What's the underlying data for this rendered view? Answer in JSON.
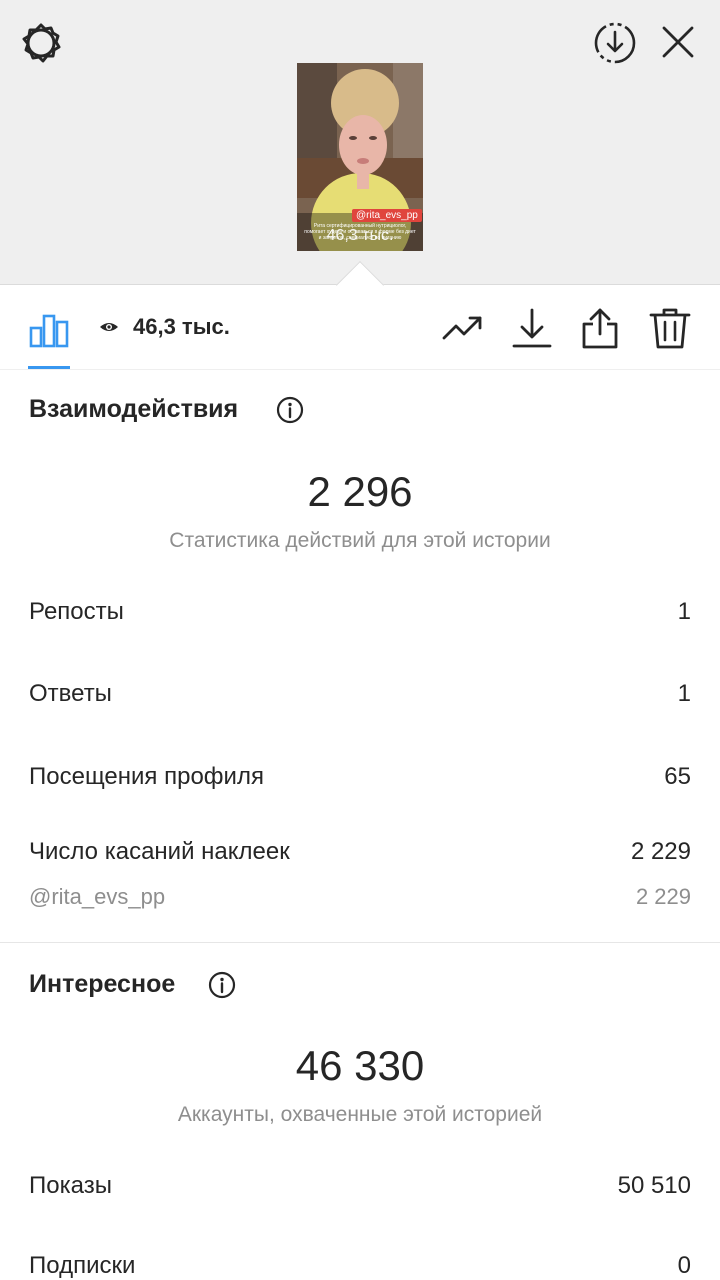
{
  "colors": {
    "accent": "#3897f0",
    "text": "#262626",
    "muted": "#8e8e8e",
    "background_top": "#efefef",
    "tag_red": "#e0453d"
  },
  "top_bar": {
    "icons": [
      "gear-icon",
      "download-circle-icon",
      "close-icon"
    ]
  },
  "story_thumbnail": {
    "tag": "@rita_evs_pp",
    "caption": "Рита сертифицированный нутрициолог, помогает худеть и оставаться в форме без диет и запретов, специалист по питанию",
    "views_overlay": "46,3 тыс."
  },
  "toolbar": {
    "views": "46,3 тыс.",
    "icons": [
      "bar-chart-icon",
      "eye-icon",
      "trending-icon",
      "download-icon",
      "share-icon",
      "trash-icon"
    ]
  },
  "interactions": {
    "title": "Взаимодействия",
    "total": "2 296",
    "subtitle": "Статистика действий для этой истории",
    "rows": [
      {
        "label": "Репосты",
        "value": "1"
      },
      {
        "label": "Ответы",
        "value": "1"
      },
      {
        "label": "Посещения профиля",
        "value": "65"
      },
      {
        "label": "Число касаний наклеек",
        "value": "2 229"
      }
    ],
    "sub_rows": [
      {
        "label": "@rita_evs_pp",
        "value": "2 229"
      }
    ]
  },
  "discovery": {
    "title": "Интересное",
    "total": "46 330",
    "subtitle": "Аккаунты, охваченные этой историей",
    "rows": [
      {
        "label": "Показы",
        "value": "50 510"
      },
      {
        "label": "Подписки",
        "value": "0"
      }
    ]
  }
}
